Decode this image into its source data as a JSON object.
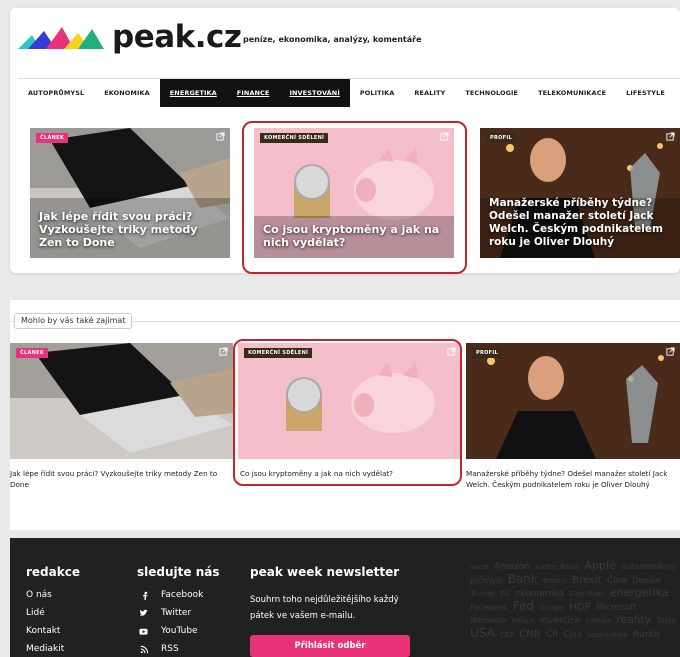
{
  "brand": {
    "name": "peak.cz",
    "tagline": "peníze, ekonomika, analýzy, komentáře",
    "logo_colors": [
      "#2fc6c6",
      "#3a3ad6",
      "#e8337a",
      "#f7d21e",
      "#1fb07d"
    ]
  },
  "nav": [
    {
      "label": "AUTOPRŮMYSL",
      "active": false
    },
    {
      "label": "EKONOMIKA",
      "active": false
    },
    {
      "label": "ENERGETIKA",
      "active": true
    },
    {
      "label": "FINANCE",
      "active": true
    },
    {
      "label": "INVESTOVÁNÍ",
      "active": true
    },
    {
      "label": "POLITIKA",
      "active": false
    },
    {
      "label": "REALITY",
      "active": false
    },
    {
      "label": "TECHNOLOGIE",
      "active": false
    },
    {
      "label": "TELEKOMUNIKACE",
      "active": false
    },
    {
      "label": "LIFESTYLE",
      "active": false
    }
  ],
  "top_tiles": [
    {
      "badge": "ČLÁNEK",
      "title": "Jak lépe řídit svou práci? Vyzkoušejte triky metody Zen to Done",
      "icon": "external-link-icon"
    },
    {
      "badge": "KOMERČNÍ SDĚLENÍ",
      "title": "Co jsou kryptoměny a jak na nich vydělat?",
      "icon": "external-link-icon"
    },
    {
      "badge": "PROFIL",
      "title": "Manažerské příběhy týdne? Odešel manažer století Jack Welch. Českým podnikatelem roku je Oliver Dlouhý",
      "icon": "external-link-icon"
    }
  ],
  "related": {
    "label": "Mohlo by vás také zajímat",
    "items": [
      {
        "badge": "ČLÁNEK",
        "caption": "Jak lépe řídit svou práci? Vyzkoušejte triky metody Zen to Done"
      },
      {
        "badge": "KOMERČNÍ SDĚLENÍ",
        "caption": "Co jsou kryptoměny a jak na nich vydělat?"
      },
      {
        "badge": "PROFIL",
        "caption": "Manažerské příběhy týdne? Odešel manažer století Jack Welch. Českým podnikatelem roku je Oliver Dlouhý"
      }
    ]
  },
  "footer": {
    "redakce": {
      "heading": "redakce",
      "links": [
        "O nás",
        "Lidé",
        "Kontakt",
        "Mediakit"
      ]
    },
    "social": {
      "heading": "sledujte nás",
      "links": [
        {
          "label": "Facebook",
          "icon": "facebook-icon"
        },
        {
          "label": "Twitter",
          "icon": "twitter-icon"
        },
        {
          "label": "YouTube",
          "icon": "youtube-icon"
        },
        {
          "label": "RSS",
          "icon": "rss-icon"
        }
      ]
    },
    "newsletter": {
      "heading": "peak week newsletter",
      "text": "Souhrn toho nejdůležitějšího každý pátek ve vašem e-mailu.",
      "button": "Přihlásit odběr"
    },
    "tags": [
      "akcie",
      "Amazon",
      "Andrej Babiš",
      "Apple",
      "automobilový průmysl",
      "Bank",
      "Bitcoin",
      "Brexit",
      "Čína",
      "Donald Trump",
      "EU",
      "ekonomika",
      "Elon Musk",
      "energetika",
      "Facebook",
      "Fed",
      "Google",
      "HDP",
      "Microsoft",
      "Nitmedia",
      "inflace",
      "investice",
      "politika",
      "reality",
      "Tesla",
      "USA",
      "ČEZ",
      "ČNB",
      "ČR",
      "Čína",
      "podnikatelé",
      "Rusko"
    ]
  }
}
